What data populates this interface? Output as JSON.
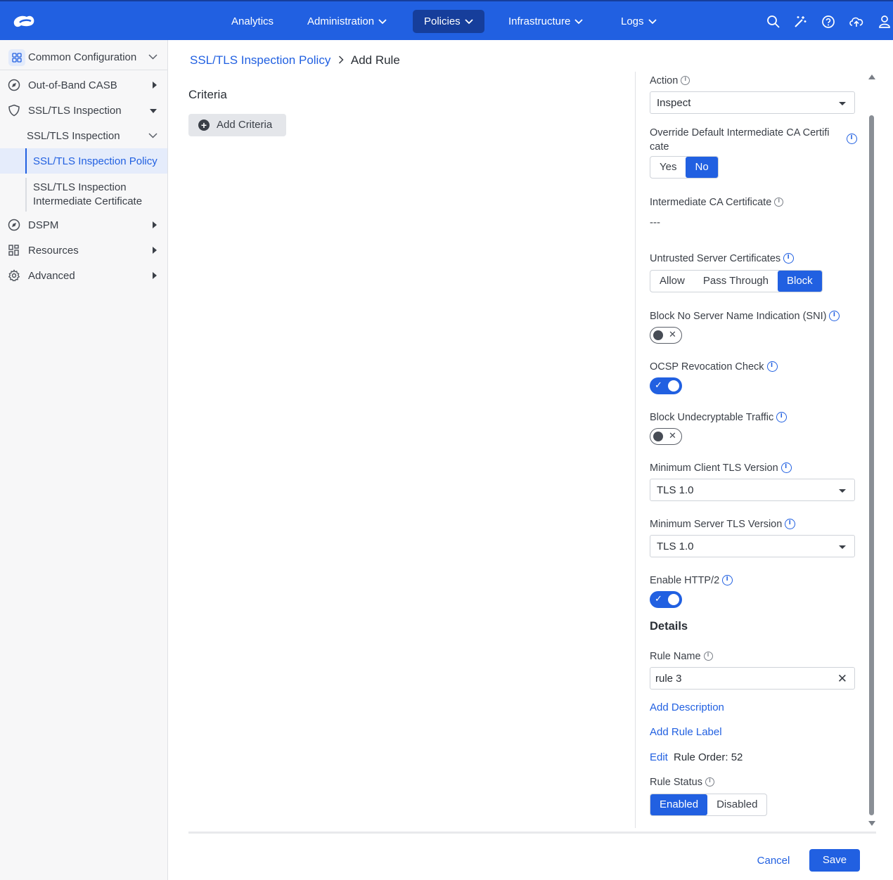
{
  "colors": {
    "brand": "#2160e1",
    "brand_dark": "#163e9b",
    "selected_bg": "#e5ecfb"
  },
  "nav": {
    "items": [
      {
        "label": "Analytics"
      },
      {
        "label": "Administration"
      },
      {
        "label": "Policies"
      },
      {
        "label": "Infrastructure"
      },
      {
        "label": "Logs"
      }
    ],
    "icons": [
      "search-icon",
      "magic-wand-icon",
      "help-icon",
      "cloud-upload-icon",
      "user-icon"
    ]
  },
  "sidebar": {
    "header": "Common Configuration",
    "items": [
      {
        "label": "Out-of-Band CASB"
      },
      {
        "label": "SSL/TLS Inspection"
      },
      {
        "label": "SSL/TLS Inspection"
      },
      {
        "label": "SSL/TLS Inspection Policy"
      },
      {
        "label": "SSL/TLS Inspection Intermediate Certificate"
      },
      {
        "label": "DSPM"
      },
      {
        "label": "Resources"
      },
      {
        "label": "Advanced"
      }
    ]
  },
  "breadcrumb": {
    "parent": "SSL/TLS Inspection Policy",
    "current": "Add Rule"
  },
  "criteria": {
    "title": "Criteria",
    "add_label": "Add Criteria"
  },
  "form": {
    "action": {
      "label": "Action",
      "value": "Inspect"
    },
    "override_ca": {
      "label_line1": "Override Default Intermediate CA Certifi",
      "label_line2": "cate",
      "options": [
        "Yes",
        "No"
      ],
      "selected": "No"
    },
    "intermediate_ca": {
      "label": "Intermediate CA Certificate",
      "value": "---"
    },
    "untrusted": {
      "label": "Untrusted Server Certificates",
      "options": [
        "Allow",
        "Pass Through",
        "Block"
      ],
      "selected": "Block"
    },
    "block_sni": {
      "label": "Block No Server Name Indication (SNI)",
      "enabled": false
    },
    "ocsp": {
      "label": "OCSP Revocation Check",
      "enabled": true
    },
    "block_undecryptable": {
      "label": "Block Undecryptable Traffic",
      "enabled": false
    },
    "min_client_tls": {
      "label": "Minimum Client TLS Version",
      "value": "TLS 1.0"
    },
    "min_server_tls": {
      "label": "Minimum Server TLS Version",
      "value": "TLS 1.0"
    },
    "http2": {
      "label": "Enable HTTP/2",
      "enabled": true
    }
  },
  "details": {
    "title": "Details",
    "rule_name_label": "Rule Name",
    "rule_name_value": "rule 3",
    "add_description": "Add Description",
    "add_rule_label": "Add Rule Label",
    "edit_label": "Edit",
    "rule_order": "Rule Order: 52",
    "rule_status_label": "Rule Status",
    "status_options": [
      "Enabled",
      "Disabled"
    ],
    "status_selected": "Enabled"
  },
  "footer": {
    "cancel": "Cancel",
    "save": "Save"
  }
}
